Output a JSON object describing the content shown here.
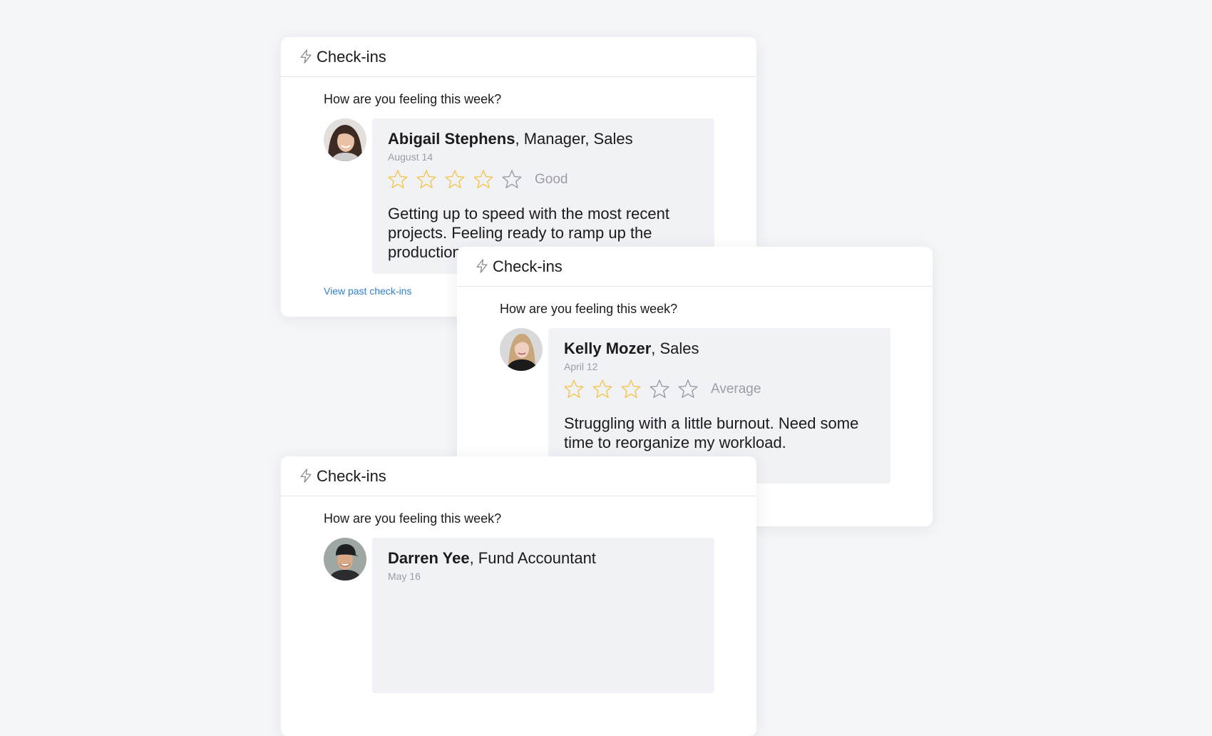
{
  "colors": {
    "page_background": "#f5f6f9",
    "card_background": "#ffffff",
    "response_background": "#f1f2f6",
    "star_filled": "#f2c64c",
    "star_empty": "#9a9ca3",
    "link": "#2f7fd4"
  },
  "cards": [
    {
      "title": "Check-ins",
      "icon": "lightning-bolt-icon",
      "question": "How are you feeling this week?",
      "person": {
        "name": "Abigail Stephens",
        "role": ", Manager, Sales",
        "avatar": "woman-smiling-avatar"
      },
      "date": "August 14",
      "rating": {
        "stars": 4,
        "max": 5,
        "label": "Good"
      },
      "response": "Getting up to speed with the most recent projects. Feeling ready to ramp up the production",
      "link": "View past check-ins"
    },
    {
      "title": "Check-ins",
      "icon": "lightning-bolt-icon",
      "question": "How are you feeling this week?",
      "person": {
        "name": "Kelly Mozer",
        "role": ", Sales",
        "avatar": "woman-blonde-avatar"
      },
      "date": "April 12",
      "rating": {
        "stars": 3,
        "max": 5,
        "label": "Average"
      },
      "response": "Struggling with a little burnout. Need some time to reorganize my workload."
    },
    {
      "title": "Check-ins",
      "icon": "lightning-bolt-icon",
      "question": "How are you feeling this week?",
      "person": {
        "name": "Darren Yee",
        "role": ", Fund Accountant",
        "avatar": "man-cap-avatar"
      },
      "date": "May 16"
    }
  ]
}
